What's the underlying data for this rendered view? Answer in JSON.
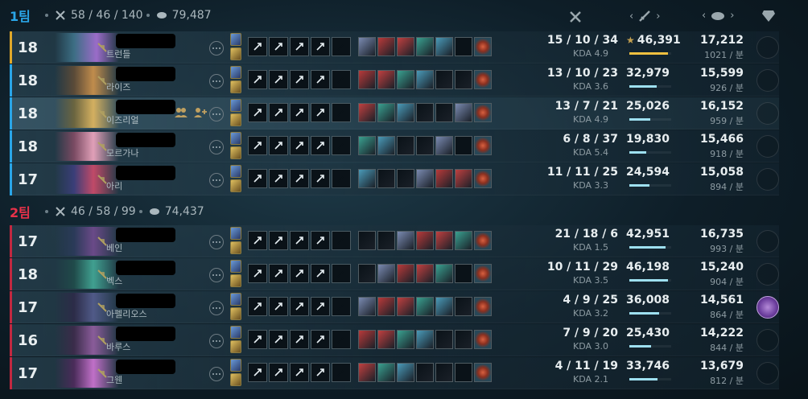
{
  "team1": {
    "name": "1팀",
    "kda": "58 / 46 / 140",
    "gold": "79,487",
    "accent": "#2aa6e8"
  },
  "team2": {
    "name": "2팀",
    "kda": "46 / 58 / 99",
    "gold": "74,437",
    "accent": "#e8324a"
  },
  "columns": {
    "kda_icon": "crossed-swords-icon",
    "damage_icon": "sword-icon",
    "gold_icon": "gold-coins-icon",
    "badge_icon": "gem-icon"
  },
  "players": [
    {
      "team": 1,
      "level": "18",
      "champion": "트런들",
      "kda": "15 / 10 / 34",
      "kda_ratio": "KDA 4.9",
      "damage": "46,391",
      "damage_share": 0.92,
      "gold": "17,212",
      "gpm": "1021 / 분",
      "top_damage": true
    },
    {
      "team": 1,
      "level": "18",
      "champion": "라이즈",
      "kda": "13 / 10 / 23",
      "kda_ratio": "KDA 3.6",
      "damage": "32,979",
      "damage_share": 0.66,
      "gold": "15,599",
      "gpm": "926 / 분"
    },
    {
      "team": 1,
      "level": "18",
      "champion": "이즈리얼",
      "kda": "13 / 7 / 21",
      "kda_ratio": "KDA 4.9",
      "damage": "25,026",
      "damage_share": 0.5,
      "gold": "16,152",
      "gpm": "959 / 분",
      "highlight": true
    },
    {
      "team": 1,
      "level": "18",
      "champion": "모르가나",
      "kda": "6 / 8 / 37",
      "kda_ratio": "KDA 5.4",
      "damage": "19,830",
      "damage_share": 0.4,
      "gold": "15,466",
      "gpm": "918 / 분"
    },
    {
      "team": 1,
      "level": "17",
      "champion": "아리",
      "kda": "11 / 11 / 25",
      "kda_ratio": "KDA 3.3",
      "damage": "24,594",
      "damage_share": 0.49,
      "gold": "15,058",
      "gpm": "894 / 분"
    },
    {
      "team": 2,
      "level": "17",
      "champion": "베인",
      "kda": "21 / 18 / 6",
      "kda_ratio": "KDA 1.5",
      "damage": "42,951",
      "damage_share": 0.86,
      "gold": "16,735",
      "gpm": "993 / 분"
    },
    {
      "team": 2,
      "level": "18",
      "champion": "벡스",
      "kda": "10 / 11 / 29",
      "kda_ratio": "KDA 3.5",
      "damage": "46,198",
      "damage_share": 0.92,
      "gold": "15,240",
      "gpm": "904 / 분"
    },
    {
      "team": 2,
      "level": "17",
      "champion": "아펠리오스",
      "kda": "4 / 9 / 25",
      "kda_ratio": "KDA 3.2",
      "damage": "36,008",
      "damage_share": 0.72,
      "gold": "14,561",
      "gpm": "864 / 분",
      "badge": true
    },
    {
      "team": 2,
      "level": "16",
      "champion": "바루스",
      "kda": "7 / 9 / 20",
      "kda_ratio": "KDA 3.0",
      "damage": "25,430",
      "damage_share": 0.51,
      "gold": "14,222",
      "gpm": "844 / 분"
    },
    {
      "team": 2,
      "level": "17",
      "champion": "그웬",
      "kda": "4 / 11 / 19",
      "kda_ratio": "KDA 2.1",
      "damage": "33,746",
      "damage_share": 0.67,
      "gold": "13,679",
      "gpm": "812 / 분"
    }
  ]
}
